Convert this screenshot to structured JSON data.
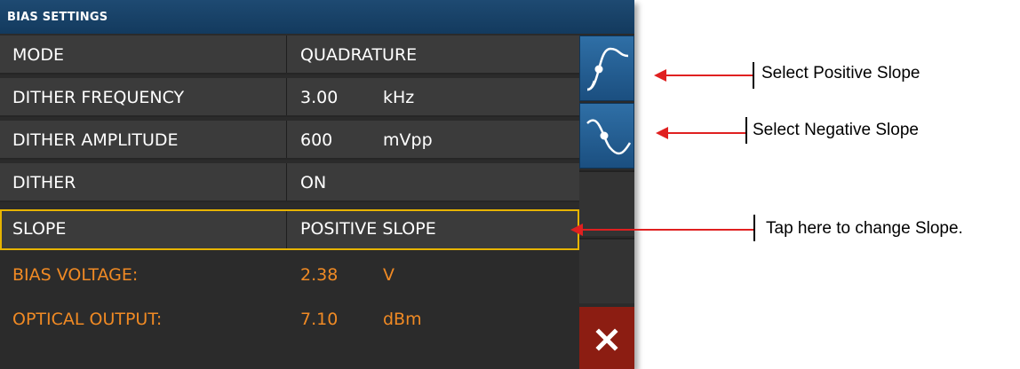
{
  "title": "BIAS SETTINGS",
  "rows": [
    {
      "label": "MODE",
      "value": "QUADRATURE",
      "unit": ""
    },
    {
      "label": "DITHER FREQUENCY",
      "value": "3.00",
      "unit": "kHz"
    },
    {
      "label": "DITHER AMPLITUDE",
      "value": "600",
      "unit": "mVpp"
    },
    {
      "label": "DITHER",
      "value": "ON",
      "unit": ""
    },
    {
      "label": "SLOPE",
      "value": "POSITIVE SLOPE",
      "unit": ""
    }
  ],
  "readouts": [
    {
      "label": "BIAS VOLTAGE:",
      "value": "2.38",
      "unit": "V"
    },
    {
      "label": "OPTICAL OUTPUT:",
      "value": "7.10",
      "unit": "dBm"
    }
  ],
  "buttons": {
    "positive_slope_icon": "positive-slope-curve",
    "negative_slope_icon": "negative-slope-curve",
    "close_icon": "close-x"
  },
  "callouts": {
    "positive": "Select Positive Slope",
    "negative": "Select Negative Slope",
    "slope": "Tap here to change Slope."
  },
  "colors": {
    "title_bar": "#1b4a74",
    "panel_bg": "#2b2b2b",
    "row_bg": "#3b3b3b",
    "readout_text": "#f08a24",
    "selected_border": "#e7b400",
    "close_button": "#8c1d12",
    "arrow": "#e02020"
  }
}
